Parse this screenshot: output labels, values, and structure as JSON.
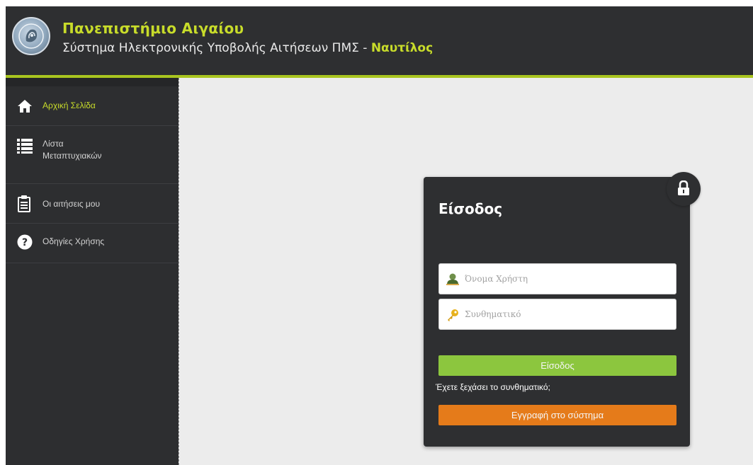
{
  "header": {
    "university": "Πανεπιστήμιο Αιγαίου",
    "subtitle": "Σύστημα Ηλεκτρονικής Υποβολής Αιτήσεων ΠΜΣ",
    "separator": " - ",
    "system_name": "Ναυτίλος"
  },
  "sidebar": {
    "items": [
      {
        "label": "Αρχική Σελίδα",
        "icon": "home-icon",
        "active": true
      },
      {
        "label": "Λίστα Μεταπτυχιακών",
        "icon": "list-icon",
        "active": false
      },
      {
        "label": "Οι αιτήσεις μου",
        "icon": "clipboard-icon",
        "active": false
      },
      {
        "label": "Οδηγίες Χρήσης",
        "icon": "help-icon",
        "active": false
      }
    ]
  },
  "login": {
    "title": "Είσοδος",
    "username_placeholder": "Όνομα Χρήστη",
    "password_placeholder": "Συνθηματικό",
    "login_button": "Είσοδος",
    "forgot_link": "Έχετε ξεχάσει το συνθηματικό;",
    "register_button": "Εγγραφή στο σύστημα"
  },
  "colors": {
    "accent": "#c8dc2a",
    "header_bg": "#2e2f31",
    "login_green": "#8cc63e",
    "register_orange": "#e57b1a"
  }
}
